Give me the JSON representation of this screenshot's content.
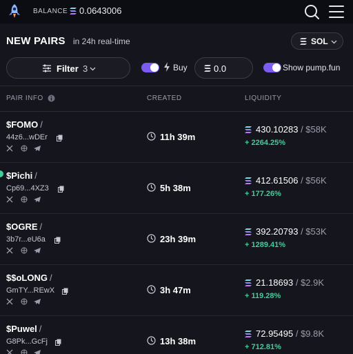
{
  "topbar": {
    "balance_label": "BALANCE",
    "balance_value": "0.0643006",
    "icons": [
      "logo-icon",
      "solana-icon",
      "search-icon",
      "menu-icon"
    ]
  },
  "header": {
    "title": "NEW PAIRS",
    "subtitle": "in 24h real-time",
    "chain": "SOL"
  },
  "controls": {
    "filter_label": "Filter",
    "filter_count": "3",
    "buy_label": "Buy",
    "amount_value": "0.0",
    "pump_label": "Show pump.fun"
  },
  "columns": {
    "pair_info": "PAIR INFO",
    "created": "CREATED",
    "liquidity": "LIQUIDITY"
  },
  "pairs": [
    {
      "symbol": "$FOMO",
      "address": "44z6...wDEr",
      "age": "11h 39m",
      "liq_sol": "430.10283",
      "liq_usd": "$58K",
      "change": "+ 2264.25%"
    },
    {
      "symbol": "$Pichi",
      "address": "Cp69...4XZ3",
      "age": "5h 38m",
      "liq_sol": "412.61506",
      "liq_usd": "$56K",
      "change": "+ 177.26%"
    },
    {
      "symbol": "$OGRE",
      "address": "3b7r...eU6a",
      "age": "23h 39m",
      "liq_sol": "392.20793",
      "liq_usd": "$53K",
      "change": "+ 1289.41%"
    },
    {
      "symbol": "$$oLONG",
      "address": "GmTY...REwX",
      "age": "3h 47m",
      "liq_sol": "21.18693",
      "liq_usd": "$2.9K",
      "change": "+ 119.28%"
    },
    {
      "symbol": "$Puwel",
      "address": "G8Pk...GcFj",
      "age": "13h 38m",
      "liq_sol": "72.95495",
      "liq_usd": "$9.8K",
      "change": "+ 712.81%"
    }
  ],
  "colors": {
    "background": "#111218",
    "accent": "#7c5cf0",
    "positive": "#3ecf9a",
    "muted": "#9a9cab"
  }
}
